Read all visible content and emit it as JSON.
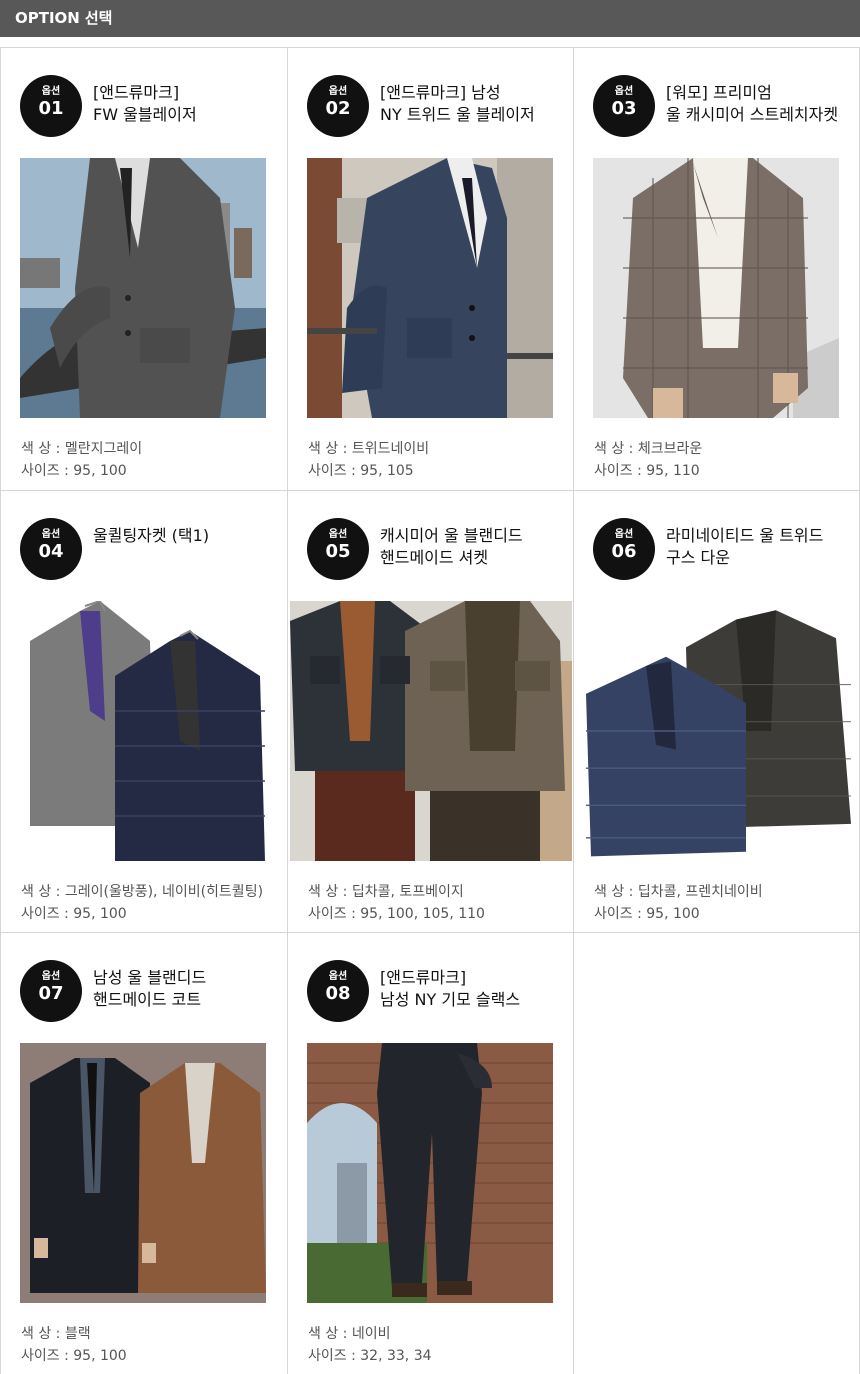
{
  "header": {
    "title_en": "OPTION",
    "title_ko": "선택"
  },
  "badge_label": "옵션",
  "spec_labels": {
    "color": "색  상 :",
    "size": "사이즈 :"
  },
  "options": [
    {
      "num": "01",
      "title": [
        "[앤드류마크]",
        "FW 울블레이저"
      ],
      "color": "멜란지그레이",
      "size": "95, 100",
      "image": "gray-wool-blazer-photo"
    },
    {
      "num": "02",
      "title": [
        "[앤드류마크] 남성",
        "NY 트위드 울 블레이저"
      ],
      "color": "트위드네이비",
      "size": "95, 105",
      "image": "navy-tweed-blazer-photo"
    },
    {
      "num": "03",
      "title": [
        "[워모] 프리미엄",
        "울 캐시미어 스트레치자켓"
      ],
      "color": "체크브라운",
      "size": "95, 110",
      "image": "brown-check-jacket-photo"
    },
    {
      "num": "04",
      "title": [
        "울퀼팅자켓 (택1)"
      ],
      "color": "그레이(울방풍), 네이비(히트퀼팅)",
      "size": "95, 100",
      "image": "quilted-jackets-photo"
    },
    {
      "num": "05",
      "title": [
        "캐시미어 울 블랜디드",
        "핸드메이드 셔켓"
      ],
      "color": "딥차콜, 토프베이지",
      "size": "95, 100, 105, 110",
      "image": "shirt-jackets-photo"
    },
    {
      "num": "06",
      "title": [
        "라미네이티드 울 트위드",
        "구스 다운"
      ],
      "color": "딥차콜, 프렌치네이비",
      "size": "95, 100",
      "image": "goose-down-jackets-photo"
    },
    {
      "num": "07",
      "title": [
        "남성 울 블랜디드",
        "핸드메이드 코트"
      ],
      "color": "블랙",
      "size": "95, 100",
      "image": "wool-coats-photo"
    },
    {
      "num": "08",
      "title": [
        "[앤드류마크]",
        "남성  NY 기모 슬랙스"
      ],
      "color": "네이비",
      "size": "32, 33, 34",
      "image": "navy-slacks-photo"
    }
  ]
}
